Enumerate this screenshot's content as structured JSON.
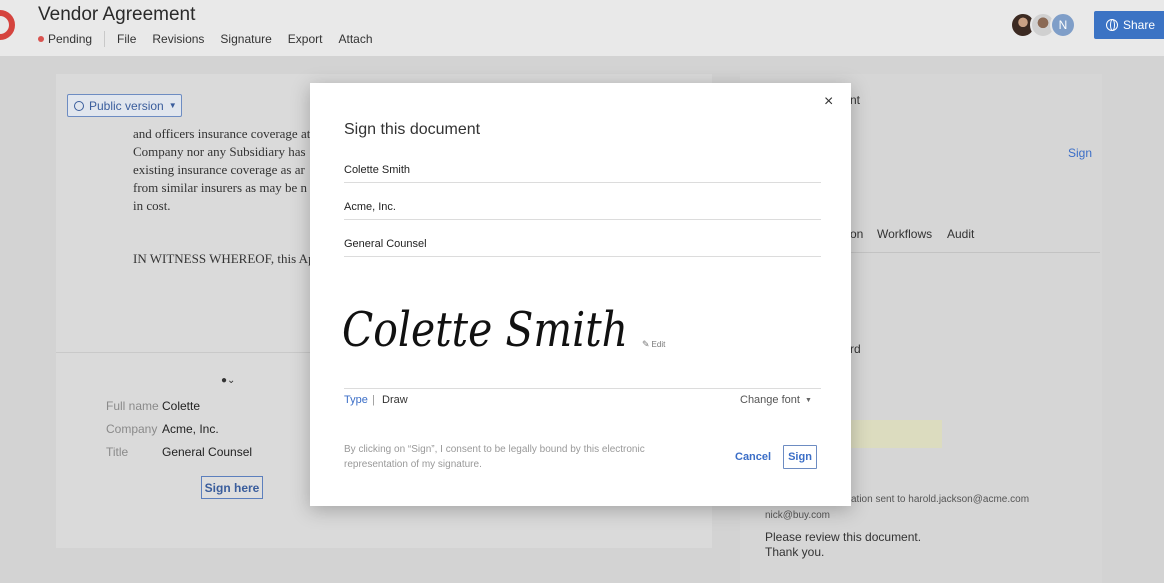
{
  "header": {
    "title": "Vendor Agreement",
    "status": "Pending",
    "menu": [
      "File",
      "Revisions",
      "Signature",
      "Export",
      "Attach"
    ],
    "avatar_initial": "N",
    "share_label": "Share"
  },
  "document": {
    "public_version_label": "Public version",
    "lines": [
      "and officers insurance coverage at",
      "Company nor any Subsidiary has",
      "existing insurance coverage as ar",
      "from similar insurers as may be n",
      "in cost.",
      "IN WITNESS WHEREOF, this Ap"
    ],
    "fields": [
      {
        "label": "Full name",
        "value": "Colette"
      },
      {
        "label": "Company",
        "value": "Acme, Inc."
      },
      {
        "label": "Title",
        "value": "General Counsel"
      }
    ],
    "sign_here_label": "Sign here"
  },
  "right_panel": {
    "header_fragment": "nt",
    "sign_link": "Sign",
    "tabs": [
      "on",
      "Workflows",
      "Audit"
    ],
    "field_fragment": "rd",
    "log_fragment": "ation sent to harold.jackson@acme.com",
    "log_email": "nick@buy.com",
    "message_line1": "Please review this document.",
    "message_line2": "Thank you."
  },
  "modal": {
    "title": "Sign this document",
    "full_name": "Colette Smith",
    "company": "Acme, Inc.",
    "job_title": "General Counsel",
    "signature_text": "Colette Smith",
    "edit_label": "Edit",
    "tab_type": "Type",
    "tab_separator": "|",
    "tab_draw": "Draw",
    "change_font_label": "Change font",
    "consent_text": "By clicking on “Sign”, I consent to be legally bound by this electronic representation of my signature.",
    "cancel_label": "Cancel",
    "sign_label": "Sign",
    "close_glyph": "×"
  },
  "colors": {
    "accent": "#3b6ec7",
    "share": "#3b73c4",
    "status_dot": "#d9534f"
  }
}
